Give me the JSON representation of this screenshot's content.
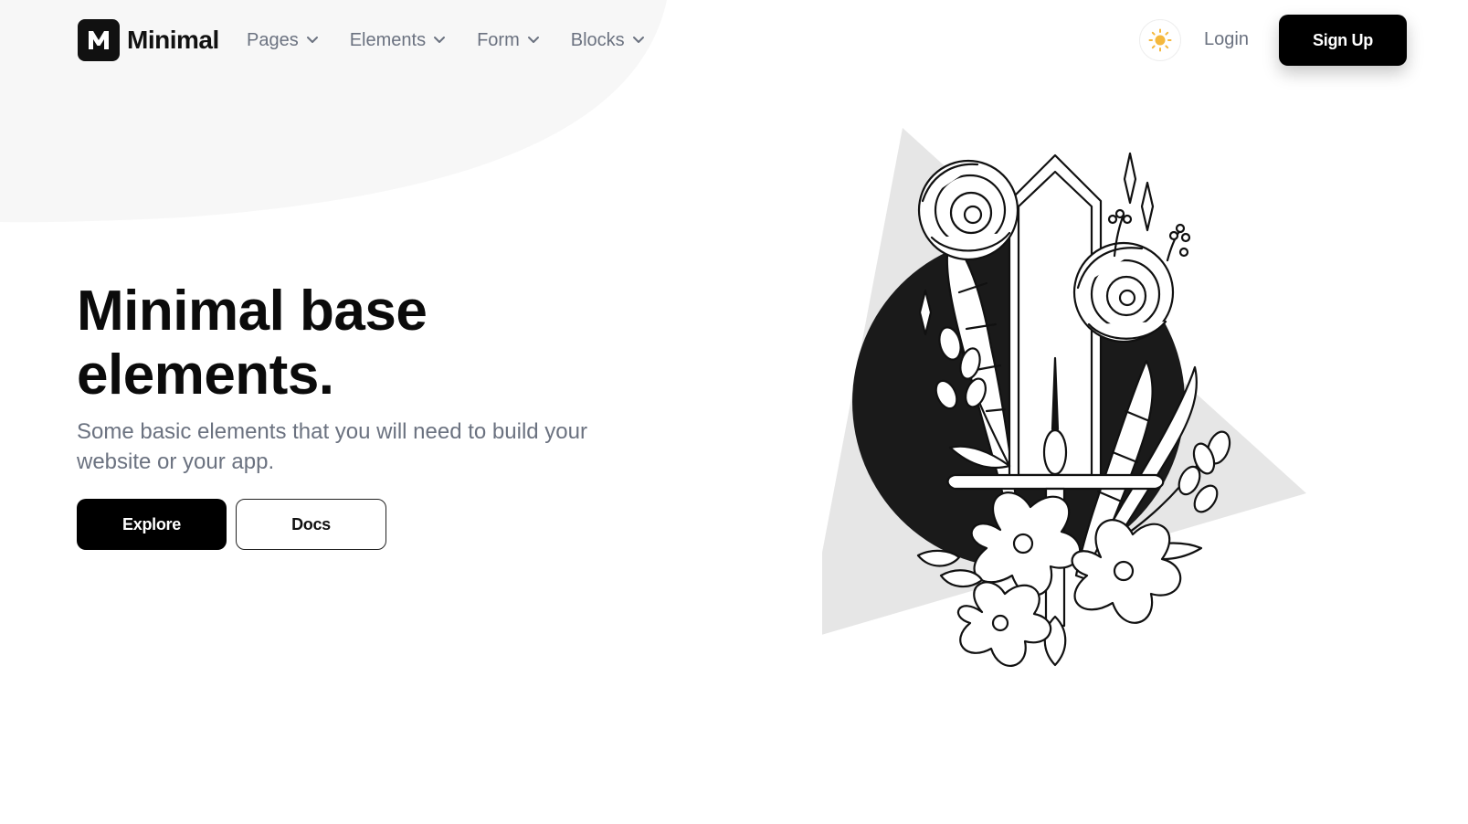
{
  "brand": {
    "name": "Minimal",
    "logo_letter": "M"
  },
  "nav": {
    "items": [
      {
        "label": "Pages"
      },
      {
        "label": "Elements"
      },
      {
        "label": "Form"
      },
      {
        "label": "Blocks"
      }
    ]
  },
  "header": {
    "login_label": "Login",
    "signup_label": "Sign Up",
    "theme_icon": "sun-icon"
  },
  "hero": {
    "title_line1": "Minimal base",
    "title_line2": "elements.",
    "subtitle": "Some basic elements that you will need to build your website or your app.",
    "primary_label": "Explore",
    "secondary_label": "Docs"
  },
  "colors": {
    "primary": "#000000",
    "muted_text": "#6b7280",
    "sun": "#f5b83d",
    "blob": "#f7f7f7",
    "triangle": "#e6e6e6",
    "circle": "#1a1a1a"
  }
}
